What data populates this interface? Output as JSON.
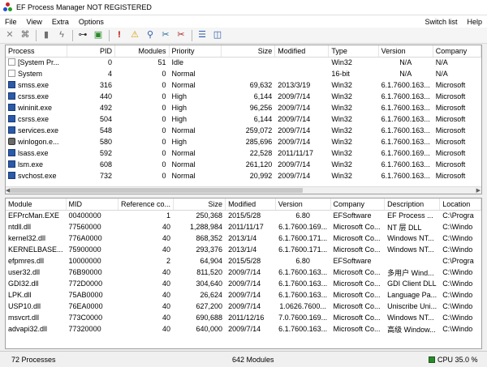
{
  "window": {
    "title": "EF Process Manager NOT REGISTERED"
  },
  "menu": {
    "items": [
      "File",
      "View",
      "Extra",
      "Options"
    ],
    "right": [
      "Switch list",
      "Help"
    ]
  },
  "toolbar": {
    "icons": [
      "close-x-icon",
      "options-icon",
      "refresh-icon",
      "lightning-icon",
      "connect-icon",
      "page-icon",
      "alert-icon",
      "warning-icon",
      "search-icon",
      "tools-icon",
      "tools-red-icon",
      "split-horizontal-icon",
      "split-vertical-icon"
    ]
  },
  "processes": {
    "columns": [
      "Process",
      "PID",
      "Modules",
      "Priority",
      "Size",
      "Modified",
      "Type",
      "Version",
      "Company"
    ],
    "rows": [
      {
        "icon": "doc",
        "name": "[System Pr...",
        "pid": "0",
        "modules": "51",
        "priority": "Idle",
        "size": "",
        "modified": "",
        "type": "Win32",
        "version": "N/A",
        "company": "N/A"
      },
      {
        "icon": "doc",
        "name": "System",
        "pid": "4",
        "modules": "0",
        "priority": "Normal",
        "size": "",
        "modified": "",
        "type": "16-bit",
        "version": "N/A",
        "company": "N/A"
      },
      {
        "icon": "app",
        "name": "smss.exe",
        "pid": "316",
        "modules": "0",
        "priority": "Normal",
        "size": "69,632",
        "modified": "2013/3/19",
        "type": "Win32",
        "version": "6.1.7600.163...",
        "company": "Microsoft"
      },
      {
        "icon": "app",
        "name": "csrss.exe",
        "pid": "440",
        "modules": "0",
        "priority": "High",
        "size": "6,144",
        "modified": "2009/7/14",
        "type": "Win32",
        "version": "6.1.7600.163...",
        "company": "Microsoft"
      },
      {
        "icon": "app",
        "name": "wininit.exe",
        "pid": "492",
        "modules": "0",
        "priority": "High",
        "size": "96,256",
        "modified": "2009/7/14",
        "type": "Win32",
        "version": "6.1.7600.163...",
        "company": "Microsoft"
      },
      {
        "icon": "app",
        "name": "csrss.exe",
        "pid": "504",
        "modules": "0",
        "priority": "High",
        "size": "6,144",
        "modified": "2009/7/14",
        "type": "Win32",
        "version": "6.1.7600.163...",
        "company": "Microsoft"
      },
      {
        "icon": "app",
        "name": "services.exe",
        "pid": "548",
        "modules": "0",
        "priority": "Normal",
        "size": "259,072",
        "modified": "2009/7/14",
        "type": "Win32",
        "version": "6.1.7600.163...",
        "company": "Microsoft"
      },
      {
        "icon": "gear",
        "name": "winlogon.e...",
        "pid": "580",
        "modules": "0",
        "priority": "High",
        "size": "285,696",
        "modified": "2009/7/14",
        "type": "Win32",
        "version": "6.1.7600.163...",
        "company": "Microsoft"
      },
      {
        "icon": "app",
        "name": "lsass.exe",
        "pid": "592",
        "modules": "0",
        "priority": "Normal",
        "size": "22,528",
        "modified": "2011/11/17",
        "type": "Win32",
        "version": "6.1.7600.169...",
        "company": "Microsoft"
      },
      {
        "icon": "app",
        "name": "lsm.exe",
        "pid": "608",
        "modules": "0",
        "priority": "Normal",
        "size": "261,120",
        "modified": "2009/7/14",
        "type": "Win32",
        "version": "6.1.7600.163...",
        "company": "Microsoft"
      },
      {
        "icon": "app",
        "name": "svchost.exe",
        "pid": "732",
        "modules": "0",
        "priority": "Normal",
        "size": "20,992",
        "modified": "2009/7/14",
        "type": "Win32",
        "version": "6.1.7600.163...",
        "company": "Microsoft"
      }
    ]
  },
  "modules": {
    "columns": [
      "Module",
      "MID",
      "Reference co...",
      "Size",
      "Modified",
      "Version",
      "Company",
      "Description",
      "Location"
    ],
    "rows": [
      {
        "module": "EFPrcMan.EXE",
        "mid": "00400000",
        "refs": "1",
        "size": "250,368",
        "modified": "2015/5/28",
        "version": "6.80",
        "company": "EFSoftware",
        "description": "EF Process ...",
        "location": "C:\\Progra"
      },
      {
        "module": "ntdll.dll",
        "mid": "77560000",
        "refs": "40",
        "size": "1,288,984",
        "modified": "2011/11/17",
        "version": "6.1.7600.169...",
        "company": "Microsoft Co...",
        "description": "NT 层 DLL",
        "location": "C:\\Windo"
      },
      {
        "module": "kernel32.dll",
        "mid": "776A0000",
        "refs": "40",
        "size": "868,352",
        "modified": "2013/1/4",
        "version": "6.1.7600.171...",
        "company": "Microsoft Co...",
        "description": "Windows NT...",
        "location": "C:\\Windo"
      },
      {
        "module": "KERNELBASE...",
        "mid": "75900000",
        "refs": "40",
        "size": "293,376",
        "modified": "2013/1/4",
        "version": "6.1.7600.171...",
        "company": "Microsoft Co...",
        "description": "Windows NT...",
        "location": "C:\\Windo"
      },
      {
        "module": "efpmres.dll",
        "mid": "10000000",
        "refs": "2",
        "size": "64,904",
        "modified": "2015/5/28",
        "version": "6.80",
        "company": "EFSoftware",
        "description": "",
        "location": "C:\\Progra"
      },
      {
        "module": "user32.dll",
        "mid": "76B90000",
        "refs": "40",
        "size": "811,520",
        "modified": "2009/7/14",
        "version": "6.1.7600.163...",
        "company": "Microsoft Co...",
        "description": "多用户 Wind...",
        "location": "C:\\Windo"
      },
      {
        "module": "GDI32.dll",
        "mid": "772D0000",
        "refs": "40",
        "size": "304,640",
        "modified": "2009/7/14",
        "version": "6.1.7600.163...",
        "company": "Microsoft Co...",
        "description": "GDI Client DLL",
        "location": "C:\\Windo"
      },
      {
        "module": "LPK.dll",
        "mid": "75AB0000",
        "refs": "40",
        "size": "26,624",
        "modified": "2009/7/14",
        "version": "6.1.7600.163...",
        "company": "Microsoft Co...",
        "description": "Language Pa...",
        "location": "C:\\Windo"
      },
      {
        "module": "USP10.dll",
        "mid": "76EA0000",
        "refs": "40",
        "size": "627,200",
        "modified": "2009/7/14",
        "version": "1.0626.7600...",
        "company": "Microsoft Co...",
        "description": "Uniscribe Uni...",
        "location": "C:\\Windo"
      },
      {
        "module": "msvcrt.dll",
        "mid": "773C0000",
        "refs": "40",
        "size": "690,688",
        "modified": "2011/12/16",
        "version": "7.0.7600.169...",
        "company": "Microsoft Co...",
        "description": "Windows NT...",
        "location": "C:\\Windo"
      },
      {
        "module": "advapi32.dll",
        "mid": "77320000",
        "refs": "40",
        "size": "640,000",
        "modified": "2009/7/14",
        "version": "6.1.7600.163...",
        "company": "Microsoft Co...",
        "description": "高级 Window...",
        "location": "C:\\Windo"
      }
    ]
  },
  "status": {
    "processes": "72 Processes",
    "modules": "642 Modules",
    "cpu": "CPU 35.0 %"
  }
}
